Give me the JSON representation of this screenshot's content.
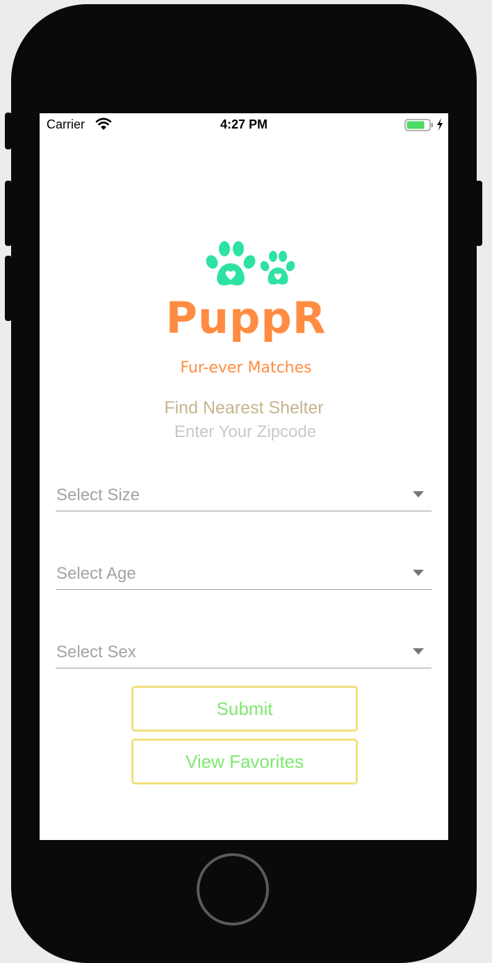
{
  "status_bar": {
    "carrier": "Carrier",
    "time": "4:27 PM",
    "battery_color": "#4cd964",
    "icons": [
      "wifi-icon",
      "battery-icon",
      "charging-bolt-icon"
    ]
  },
  "logo": {
    "brand": "PuppR",
    "tagline": "Fur-ever Matches",
    "paw_color": "#2ee2a2",
    "brand_color": "#ff8c42"
  },
  "search": {
    "title": "Find Nearest Shelter",
    "zip_placeholder": "Enter Your Zipcode",
    "zip_value": ""
  },
  "filters": [
    {
      "label": "Select Size",
      "icon": "chevron-down-icon"
    },
    {
      "label": "Select Age",
      "icon": "chevron-down-icon"
    },
    {
      "label": "Select Sex",
      "icon": "chevron-down-icon"
    }
  ],
  "actions": {
    "submit_label": "Submit",
    "favorites_label": "View Favorites",
    "border_color": "#f2e07a",
    "text_color": "#7de86d"
  }
}
